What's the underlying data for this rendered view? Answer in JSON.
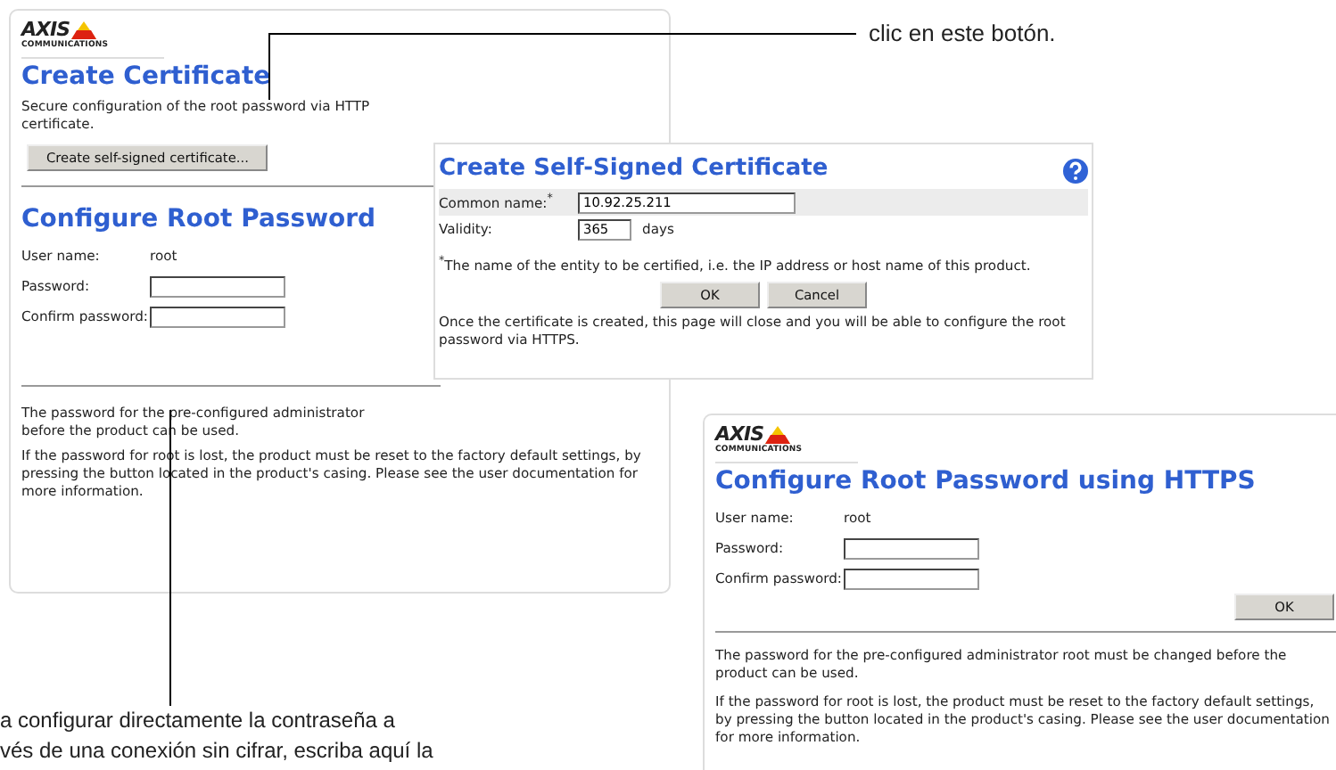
{
  "callouts": [
    {
      "text": "clic en este botón."
    },
    {
      "text": "a configurar directamente la contraseña a\nvés de una conexión sin cifrar, escriba aquí la"
    }
  ],
  "certificate_page": {
    "logo": {
      "name": "AXIS",
      "tagline": "COMMUNICATIONS"
    },
    "title": "Create Certificate",
    "intro": [
      "Secure configuration of the root password via HTTP",
      "certificate."
    ],
    "button": "Create self-signed certificate...",
    "section_title": "Configure Root Password",
    "fields": [
      {
        "kind": "text",
        "label": "User name:",
        "value": "root"
      },
      {
        "kind": "input",
        "label": "Password:"
      },
      {
        "kind": "input",
        "label": "Confirm password:"
      }
    ],
    "notes": [
      "The password for the pre-configured administrator",
      "before the product can be used."
    ],
    "note2": "If the password for root is lost, the product must be reset to the factory default settings, by pressing the button located in the product's casing. Please see the user documentation for more information."
  },
  "dialog": {
    "title": "Create Self-Signed Certificate",
    "fields": [
      {
        "label": "Common name:$^{*}$",
        "value": "10.92.25.211",
        "shaded": true
      },
      {
        "label": "Validity:",
        "value": "365",
        "unit": "days",
        "shaded": false
      }
    ],
    "footnote": "$^{*}$The name of the entity to be certified, i.e. the IP address or host name of this product.",
    "buttons": [
      "OK",
      "Cancel"
    ],
    "message": "Once the certificate is created, this page will close and you will be able to configure the root password via HTTPS."
  },
  "https_page": {
    "logo": {
      "name": "AXIS",
      "tagline": "COMMUNICATIONS"
    },
    "title": "Configure Root Password using HTTPS",
    "fields": [
      {
        "kind": "text",
        "label": "User name:",
        "value": "root"
      },
      {
        "kind": "input",
        "label": "Password:"
      },
      {
        "kind": "input",
        "label": "Confirm password:"
      }
    ],
    "button": "OK",
    "notes": [
      "The password for the pre-configured administrator root must be changed before the product can be used.",
      "If the password for root is lost, the product must be reset to the factory default settings, by pressing the button located in the product's casing. Please see the user documentation for more information."
    ]
  }
}
